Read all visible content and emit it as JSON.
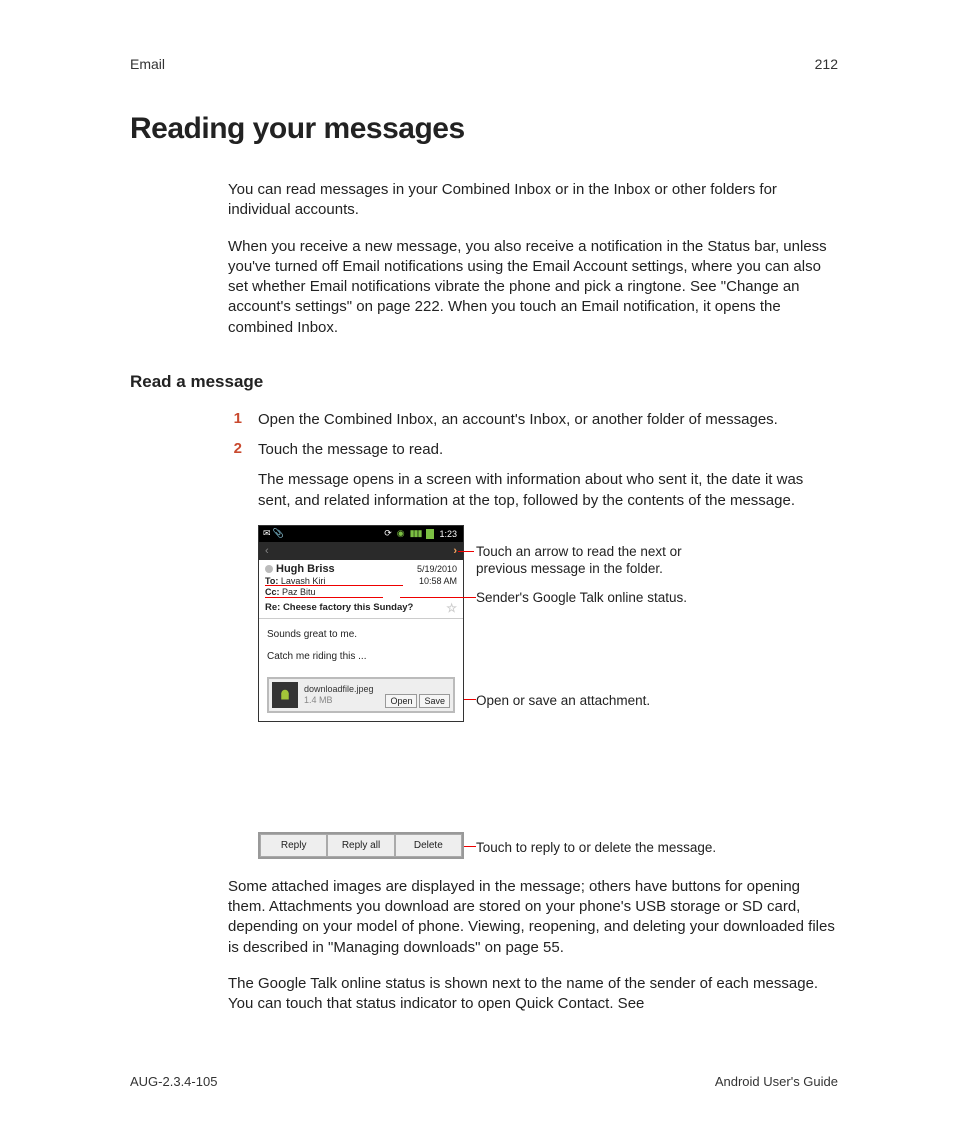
{
  "header": {
    "section": "Email",
    "page_number": "212"
  },
  "title": "Reading your messages",
  "intro_p1": "You can read messages in your Combined Inbox or in the Inbox or other folders for individual accounts.",
  "intro_p2": "When you receive a new message, you also receive a notification in the Status bar, unless you've turned off Email notifications using the Email Account settings, where you can also set whether Email notifications vibrate the phone and pick a ringtone. See \"Change an account's settings\" on page 222. When you touch an Email notification, it opens the combined Inbox.",
  "subheading": "Read a message",
  "steps": {
    "s1_num": "1",
    "s1_txt": "Open the Combined Inbox, an account's Inbox, or another folder of messages.",
    "s2_num": "2",
    "s2_txt": "Touch the message to read.",
    "s2_sub": "The message opens in a screen with information about who sent it, the date it was sent, and related information at the top, followed by the contents of the message."
  },
  "screenshot": {
    "status": {
      "time": "1:23"
    },
    "sender": "Hugh Briss",
    "date": "5/19/2010",
    "to_label": "To:",
    "to_val": "Lavash Kiri",
    "time": "10:58 AM",
    "cc_label": "Cc:",
    "cc_val": "Paz Bitu",
    "subject": "Re: Cheese factory this Sunday?",
    "body1": "Sounds great to me.",
    "body2": "Catch me riding this ...",
    "attach_name": "downloadfile.jpeg",
    "attach_size": "1.4 MB",
    "open_btn": "Open",
    "save_btn": "Save"
  },
  "callouts": {
    "c1": "Touch an arrow to read the next or previous message in the folder.",
    "c2": "Sender's Google Talk online status.",
    "c3": "Open or save an attachment.",
    "c4": "Touch to reply to or delete the message."
  },
  "action_buttons": {
    "reply": "Reply",
    "reply_all": "Reply all",
    "delete": "Delete"
  },
  "p_after1": "Some attached images are displayed in the message; others have buttons for opening them. Attachments you download are stored on your phone's USB storage or SD card, depending on your model of phone. Viewing, reopening, and deleting your downloaded files is described in \"Managing downloads\" on page 55.",
  "p_after2": "The Google Talk online status is shown next to the name of the sender of each message. You can touch that status indicator to open Quick Contact. See",
  "footer": {
    "left": "AUG-2.3.4-105",
    "right": "Android User's Guide"
  }
}
